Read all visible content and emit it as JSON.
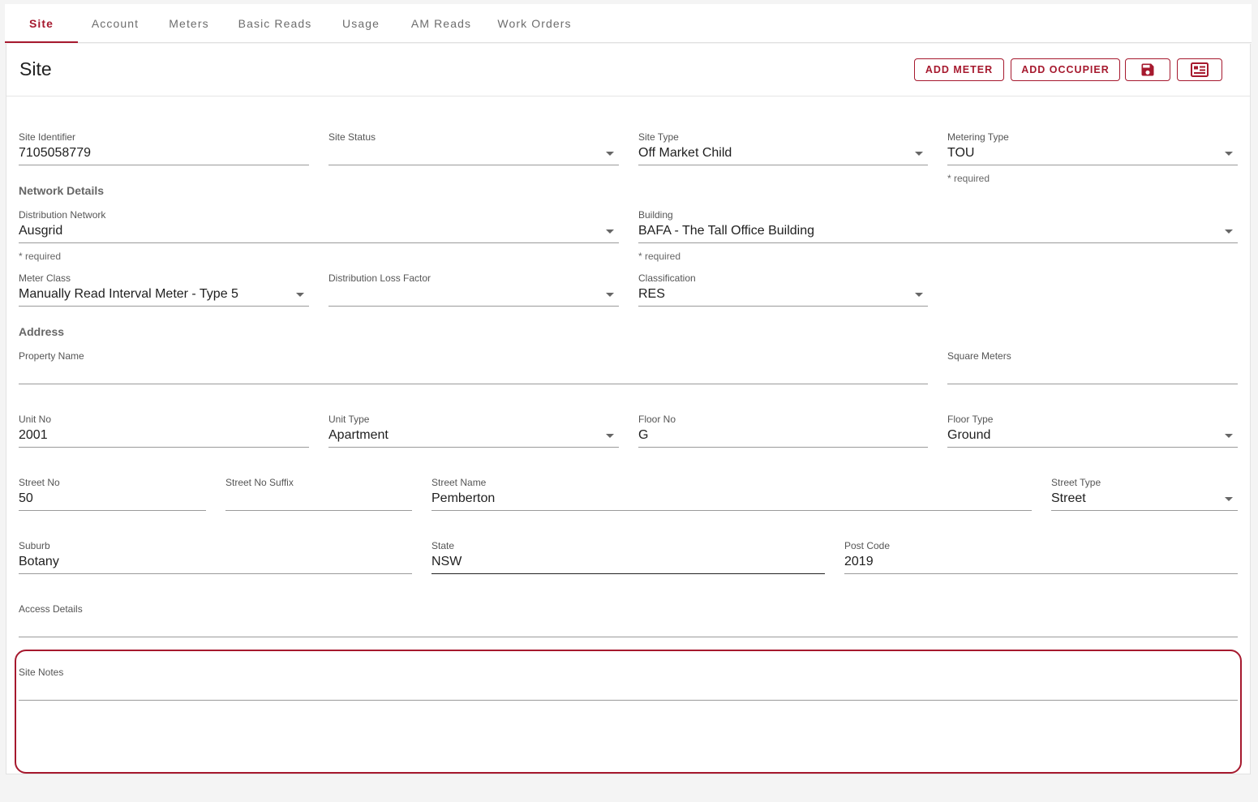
{
  "tabs": [
    {
      "label": "Site",
      "active": true
    },
    {
      "label": "Account"
    },
    {
      "label": "Meters"
    },
    {
      "label": "Basic Reads"
    },
    {
      "label": "Usage"
    },
    {
      "label": "AM Reads"
    },
    {
      "label": "Work Orders"
    }
  ],
  "header": {
    "title": "Site",
    "add_meter_label": "ADD METER",
    "add_occupier_label": "ADD OCCUPIER",
    "save_icon": "save-icon",
    "details_icon": "id-card-icon"
  },
  "fields": {
    "site_identifier": {
      "label": "Site Identifier",
      "value": "7105058779"
    },
    "site_status": {
      "label": "Site Status",
      "value": ""
    },
    "site_type": {
      "label": "Site Type",
      "value": "Off Market Child"
    },
    "metering_type": {
      "label": "Metering Type",
      "value": "TOU",
      "hint": "* required"
    },
    "distribution_network": {
      "label": "Distribution Network",
      "value": "Ausgrid",
      "hint": "* required"
    },
    "building": {
      "label": "Building",
      "value": "BAFA - The Tall Office Building",
      "hint": "* required"
    },
    "meter_class": {
      "label": "Meter Class",
      "value": "Manually Read Interval Meter - Type 5"
    },
    "distribution_loss_factor": {
      "label": "Distribution Loss Factor",
      "value": ""
    },
    "classification": {
      "label": "Classification",
      "value": "RES"
    },
    "property_name": {
      "label": "Property Name",
      "value": ""
    },
    "square_meters": {
      "label": "Square Meters",
      "value": ""
    },
    "unit_no": {
      "label": "Unit No",
      "value": "2001"
    },
    "unit_type": {
      "label": "Unit Type",
      "value": "Apartment"
    },
    "floor_no": {
      "label": "Floor No",
      "value": "G"
    },
    "floor_type": {
      "label": "Floor Type",
      "value": "Ground"
    },
    "street_no": {
      "label": "Street No",
      "value": "50"
    },
    "street_no_suffix": {
      "label": "Street No Suffix",
      "value": ""
    },
    "street_name": {
      "label": "Street Name",
      "value": "Pemberton"
    },
    "street_type": {
      "label": "Street Type",
      "value": "Street"
    },
    "suburb": {
      "label": "Suburb",
      "value": "Botany"
    },
    "state": {
      "label": "State",
      "value": "NSW"
    },
    "post_code": {
      "label": "Post Code",
      "value": "2019"
    },
    "access_details": {
      "label": "Access Details",
      "value": ""
    },
    "site_notes": {
      "label": "Site Notes",
      "value": ""
    }
  },
  "sections": {
    "network_details": "Network Details",
    "address": "Address"
  },
  "colors": {
    "accent": "#a6192e",
    "background": "#f4f4f4"
  }
}
